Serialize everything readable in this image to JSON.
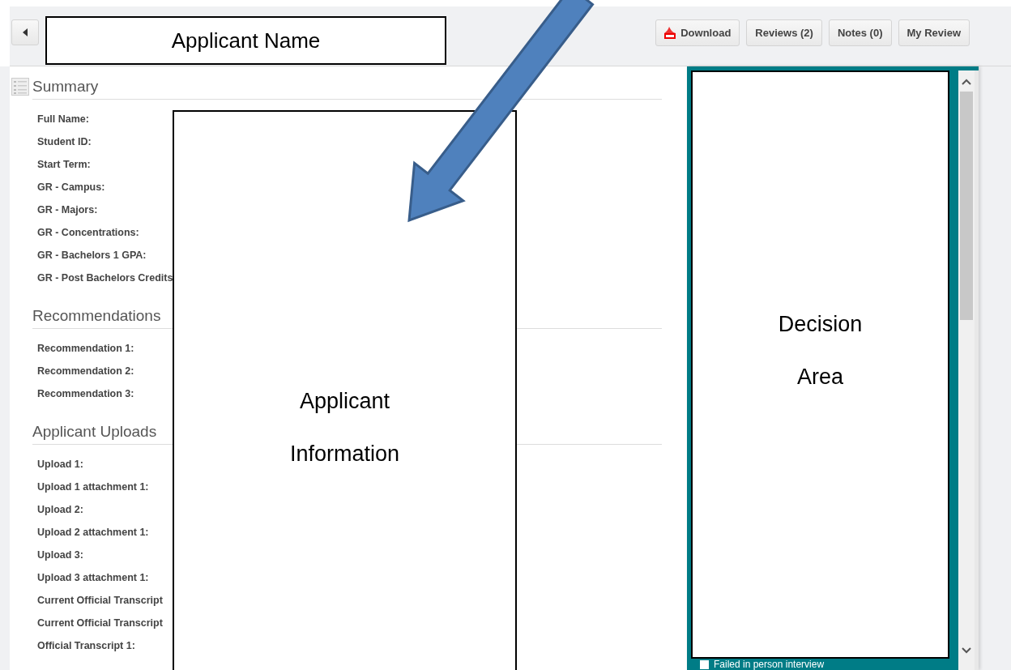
{
  "header": {
    "title_box": "Applicant Name",
    "buttons": [
      {
        "label": "Download",
        "kind": "pdf"
      },
      {
        "label": "Reviews (2)",
        "kind": "plain"
      },
      {
        "label": "Notes (0)",
        "kind": "plain"
      },
      {
        "label": "My Review",
        "kind": "plain"
      }
    ]
  },
  "sections": [
    {
      "title": "Summary",
      "kind": "with-icon",
      "fields": [
        "Full Name:",
        "Student ID:",
        "Start Term:",
        "GR - Campus:",
        "GR - Majors:",
        "GR - Concentrations:",
        "GR - Bachelors 1 GPA:",
        "GR - Post Bachelors Credits"
      ]
    },
    {
      "title": "Recommendations",
      "kind": "plain",
      "fields": [
        "Recommendation 1:",
        "Recommendation 2:",
        "Recommendation 3:"
      ]
    },
    {
      "title": "Applicant Uploads",
      "kind": "plain",
      "fields": [
        "Upload 1:",
        "Upload 1 attachment 1:",
        "Upload 2:",
        "Upload 2 attachment 1:",
        "Upload 3:",
        "Upload 3 attachment 1:",
        "Current Official Transcript",
        "Current Official Transcript",
        "Official Transcript 1:"
      ]
    }
  ],
  "applicant_info": {
    "lines": [
      "Applicant",
      "Information"
    ]
  },
  "decision": {
    "lines": [
      "Decision",
      "Area"
    ],
    "checkbox": {
      "label": "Failed in person interview",
      "checked": false
    }
  }
}
